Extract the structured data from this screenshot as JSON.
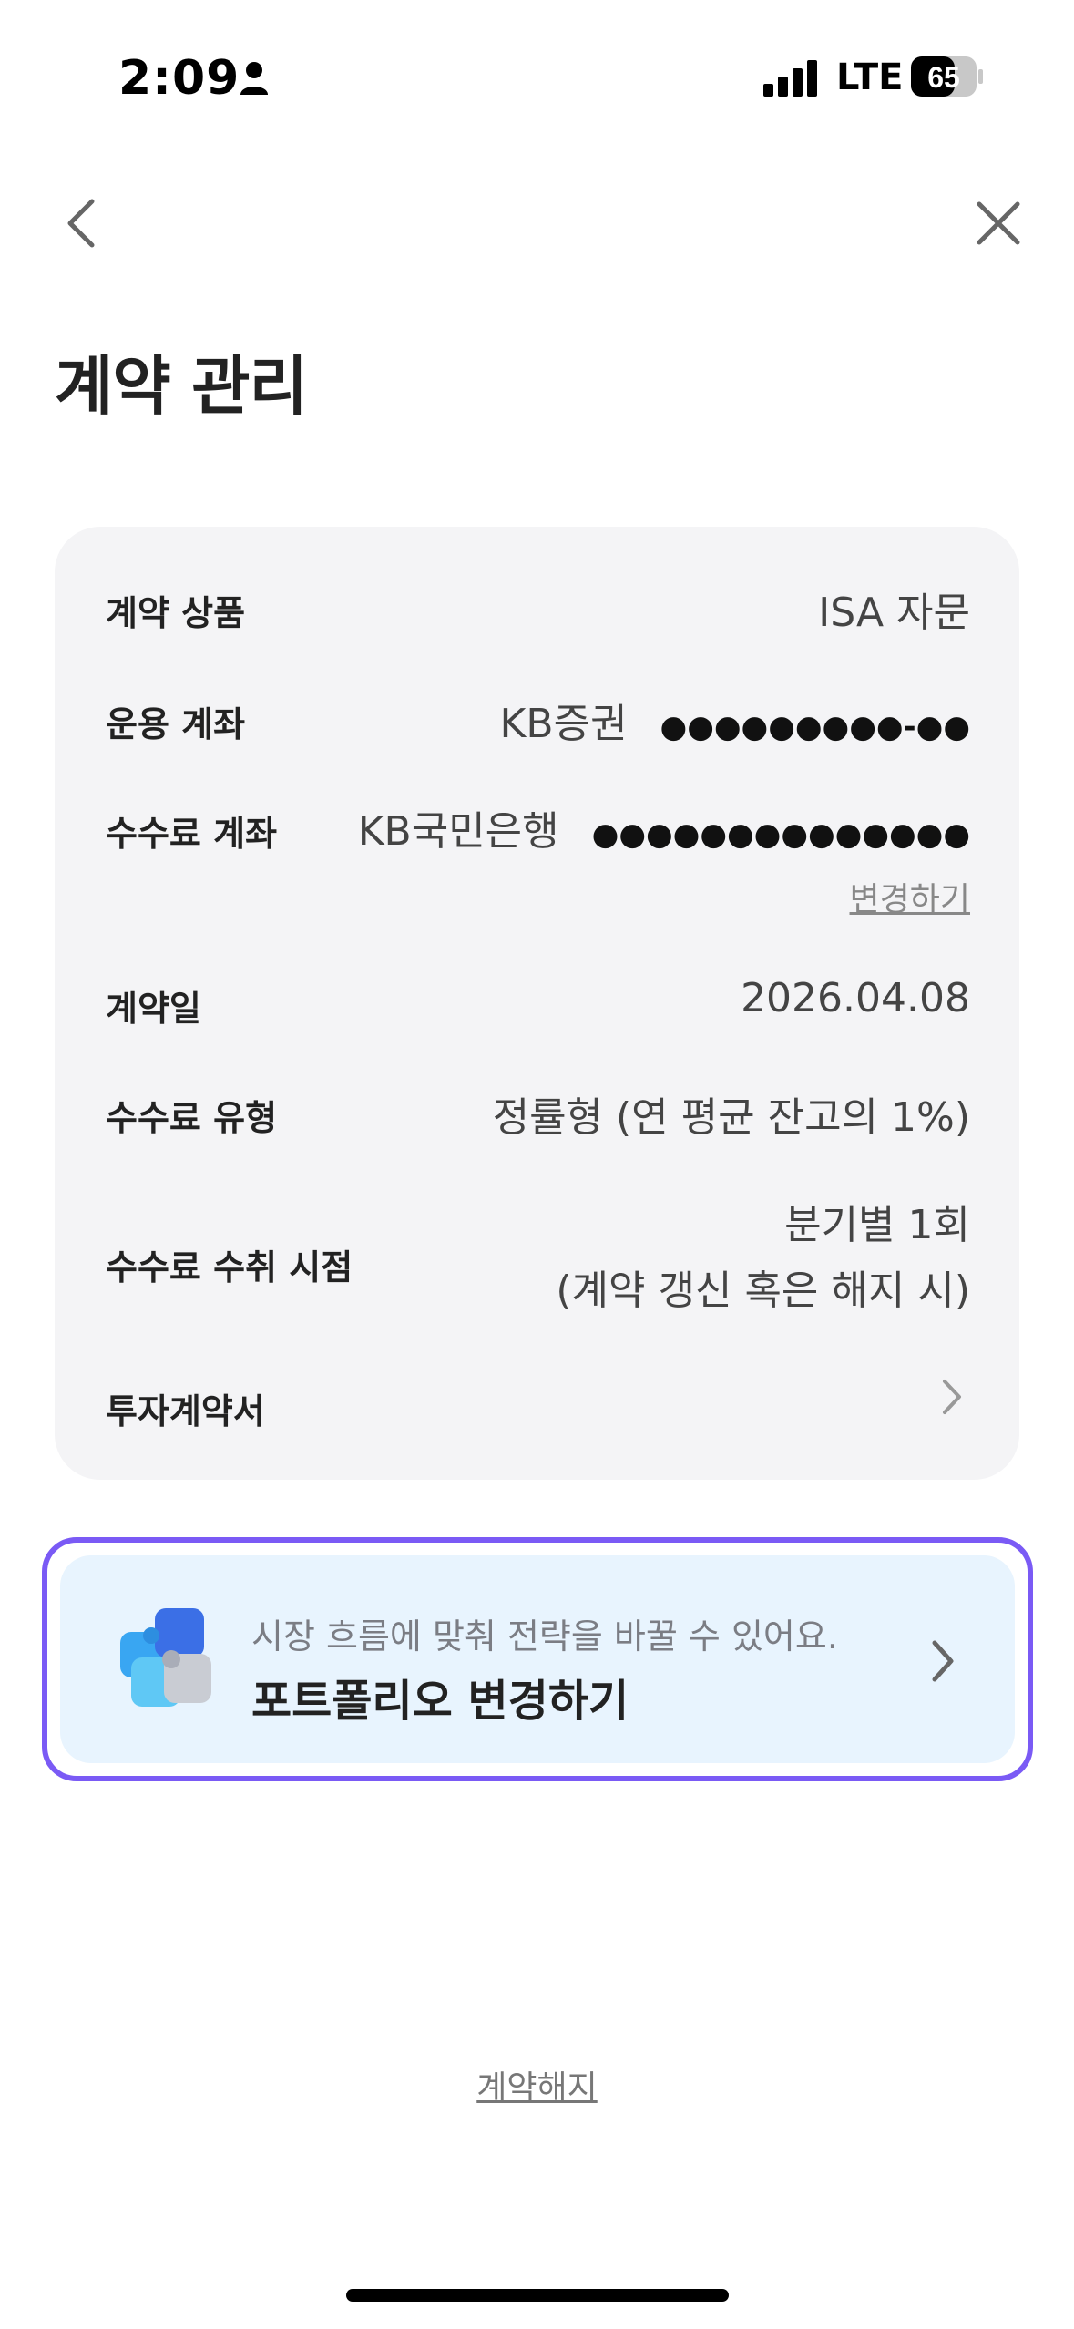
{
  "status_bar": {
    "time": "2:09",
    "network": "LTE",
    "battery": "65"
  },
  "nav": {
    "back_icon": "chevron-left-icon",
    "close_icon": "close-icon"
  },
  "page": {
    "title": "계약 관리"
  },
  "contract": {
    "rows": [
      {
        "label": "계약 상품",
        "value": "ISA 자문"
      },
      {
        "label": "운용 계좌",
        "value": "KB증권",
        "masked": "●●●●●●●●●-●●"
      },
      {
        "label": "수수료 계좌",
        "value": "KB국민은행",
        "masked": "●●●●●●●●●●●●●●",
        "action": "변경하기"
      },
      {
        "label": "계약일",
        "value": "2026.04.08"
      },
      {
        "label": "수수료 유형",
        "value": "정률형 (연 평균 잔고의 1%)"
      },
      {
        "label": "수수료 수취 시점",
        "value_line1": "분기별 1회",
        "value_line2": "(계약 갱신 혹은 해지 시)"
      },
      {
        "label": "투자계약서",
        "icon": "chevron-right-icon"
      }
    ]
  },
  "banner": {
    "subtitle": "시장 흐름에 맞춰 전략을 바꿀 수 있어요.",
    "title": "포트폴리오 변경하기",
    "icon": "puzzle-icon",
    "accent_color": "#7a5af5",
    "background_color": "#e8f4fe"
  },
  "footer": {
    "terminate_label": "계약해지"
  }
}
